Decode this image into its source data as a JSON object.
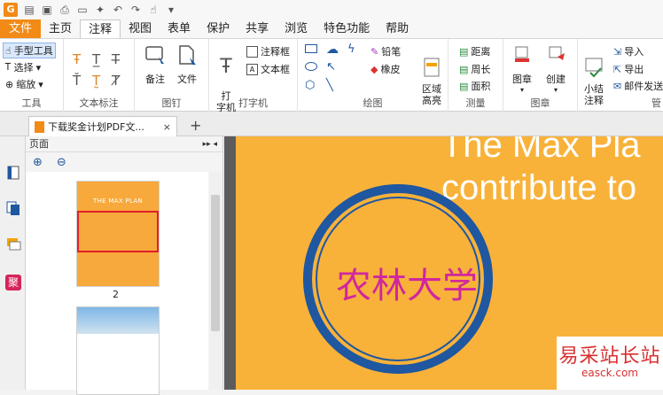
{
  "menu": {
    "tabs": [
      "文件",
      "主页",
      "注释",
      "视图",
      "表单",
      "保护",
      "共享",
      "浏览",
      "特色功能",
      "帮助"
    ],
    "active": "注释"
  },
  "ribbon": {
    "tools": {
      "hand": "手型工具",
      "select": "选择",
      "zoom": "缩放",
      "label": "工具"
    },
    "text_markup": {
      "label": "文本标注"
    },
    "pin": {
      "note": "备注",
      "file": "文件",
      "label": "图钉"
    },
    "typewriter": {
      "type": "打\n字机",
      "callout": "注释框",
      "textbox": "文本框",
      "label": "打字机"
    },
    "drawing": {
      "pencil": "铅笔",
      "eraser": "橡皮",
      "area": "区域\n高亮",
      "label": "绘图"
    },
    "measure": {
      "distance": "距离",
      "perimeter": "周长",
      "area": "面积",
      "label": "测量"
    },
    "stamp": {
      "stamp": "图章",
      "create": "创建",
      "label": "图章"
    },
    "manage": {
      "summary": "小结\n注释",
      "import": "导入",
      "export": "导出",
      "email": "邮件发送",
      "label": "管"
    }
  },
  "doc_tab": {
    "title": "下载奖金计划PDF文...",
    "close": "×",
    "new": "+"
  },
  "panel": {
    "title": "页面",
    "thumb1_title": "THE MAX PLAN",
    "page_number": "2"
  },
  "document": {
    "line1": "The Max Pla",
    "line2": "contribute to",
    "stamp_text": "农林大学"
  },
  "watermark": {
    "cn": "易采站长站",
    "en": "easck.com"
  },
  "colors": {
    "accent": "#f28a16",
    "stamp_ring": "#1f57a0",
    "stamp_text": "#d0279f",
    "page_bg": "#f8b23a"
  }
}
